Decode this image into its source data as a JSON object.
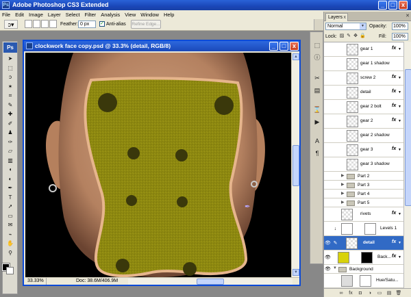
{
  "app": {
    "title": "Adobe Photoshop CS3 Extended",
    "icon_letters": "Ps"
  },
  "window_buttons": {
    "minimize": "_",
    "maximize": "□",
    "close": "x"
  },
  "menu": [
    "File",
    "Edit",
    "Image",
    "Layer",
    "Select",
    "Filter",
    "Analysis",
    "View",
    "Window",
    "Help"
  ],
  "options_bar": {
    "feather_label": "Feather:",
    "feather_value": "0 px",
    "antialias_label": "Anti-alias",
    "antialias_checked": "✓",
    "refine_edge_label": "Refine Edge..."
  },
  "toolbox": {
    "logo": "Ps",
    "tools": [
      {
        "name": "move-tool-icon",
        "glyph": "➤"
      },
      {
        "name": "marquee-tool-icon",
        "glyph": "⬚"
      },
      {
        "name": "lasso-tool-icon",
        "glyph": "ↄ"
      },
      {
        "name": "magic-wand-tool-icon",
        "glyph": "✶"
      },
      {
        "name": "crop-tool-icon",
        "glyph": "⌗"
      },
      {
        "name": "slice-tool-icon",
        "glyph": "✎"
      },
      {
        "name": "healing-brush-tool-icon",
        "glyph": "✚"
      },
      {
        "name": "brush-tool-icon",
        "glyph": "✐"
      },
      {
        "name": "clone-stamp-tool-icon",
        "glyph": "♟"
      },
      {
        "name": "history-brush-tool-icon",
        "glyph": "✑"
      },
      {
        "name": "eraser-tool-icon",
        "glyph": "▱"
      },
      {
        "name": "gradient-tool-icon",
        "glyph": "▥"
      },
      {
        "name": "blur-tool-icon",
        "glyph": "◖"
      },
      {
        "name": "dodge-tool-icon",
        "glyph": "◐"
      },
      {
        "name": "pen-tool-icon",
        "glyph": "✒"
      },
      {
        "name": "type-tool-icon",
        "glyph": "T"
      },
      {
        "name": "path-selection-tool-icon",
        "glyph": "➚"
      },
      {
        "name": "shape-tool-icon",
        "glyph": "▭"
      },
      {
        "name": "notes-tool-icon",
        "glyph": "✉"
      },
      {
        "name": "eyedropper-tool-icon",
        "glyph": "⌁"
      },
      {
        "name": "hand-tool-icon",
        "glyph": "✋"
      },
      {
        "name": "zoom-tool-icon",
        "glyph": "⚲"
      }
    ]
  },
  "document": {
    "title": "clockwork face copy.psd @ 33.3% (detail, RGB/8)",
    "zoom": "33.33%",
    "doc_info": "Doc: 38.6M/406.9M"
  },
  "layers_panel": {
    "tab_label": "Layers",
    "tab_close": "x",
    "panel_close": "✕",
    "blend_mode": "Normal",
    "opacity_label": "Opacity:",
    "opacity_value": "100%",
    "lock_label": "Lock:",
    "fill_label": "Fill:",
    "fill_value": "100%",
    "layers": [
      {
        "name": "gear 1",
        "fx": "fx"
      },
      {
        "name": "gear 1 shadow",
        "fx": ""
      },
      {
        "name": "screw 2",
        "fx": "fx"
      },
      {
        "name": "detail",
        "fx": "fx"
      },
      {
        "name": "gear 2 bolt",
        "fx": "fx"
      },
      {
        "name": "gear 2",
        "fx": "fx"
      },
      {
        "name": "gear 2 shadow",
        "fx": ""
      },
      {
        "name": "gear 3",
        "fx": "fx"
      },
      {
        "name": "gear 3 shadow",
        "fx": ""
      }
    ],
    "groups": [
      "Part 2",
      "Part 3",
      "Part 4",
      "Part 5"
    ],
    "rivets_layer": {
      "name": "rivets",
      "fx": "fx"
    },
    "levels_layer": {
      "name": "Levels 1"
    },
    "detail_layer": {
      "name": "detail",
      "fx": "fx"
    },
    "back_layer": {
      "name": "Back...",
      "fx": "fx"
    },
    "background_group": "Background",
    "huesat_layer": {
      "name": "Hue/Satu..."
    },
    "footer_icons": [
      "∞",
      "fx",
      "◘",
      "◑",
      "▭",
      "▤",
      "🗑"
    ]
  }
}
